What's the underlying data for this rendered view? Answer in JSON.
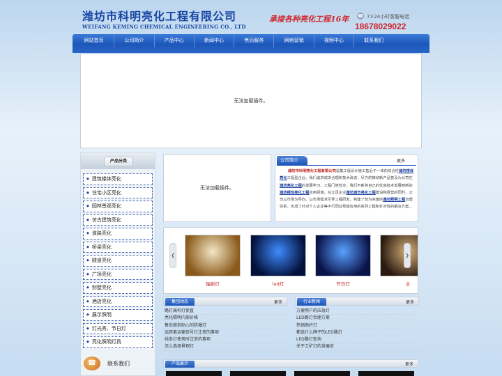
{
  "header": {
    "company_cn": "潍坊市科明亮化工程有限公司",
    "company_en": "WEIFANG KEMING CHEMICAL ENGINEERING CO., LTD",
    "slogan": "承接各种亮化工程16年",
    "hotline_label": "7×24小时客服电话",
    "hotline_number": "18678029022"
  },
  "nav": {
    "items": [
      "网站首页",
      "公司简介",
      "产品中心",
      "新闻中心",
      "售后服务",
      "网络营销",
      "视频中心",
      "联系我们"
    ]
  },
  "banner": {
    "plugin_message": "无法加载插件。"
  },
  "sidebar": {
    "title": "产品分类",
    "categories": [
      "建筑楼体亮化",
      "住宅小区亮化",
      "园林景观亮化",
      "仿古建筑亮化",
      "道路亮化",
      "桥梁亮化",
      "隧道亮化",
      "广场亮化",
      "别墅亮化",
      "酒店亮化",
      "展示照明",
      "灯光秀、节日灯",
      "亮化照明灯具"
    ],
    "contact_title": "联系我们"
  },
  "flash2": {
    "plugin_message": "无法加载插件。"
  },
  "about": {
    "tab": "公司简介",
    "more": "更多",
    "seg1": "潍坊市科明亮化工程有限公司",
    "seg2": "是集工程设计施工售后于一体的综合性",
    "seg3": "潍坊楼体亮化",
    "seg4": "工程型企业。我们追求成本合理和技术改进，尽力的推动新产品普及为公司在",
    "seg5": "潍坊亮化工程",
    "seg6": "的发展学习、工程门类较全，我们不断将自己的优良技术发展到新的",
    "seg7": "潍坊楼体亮化工程",
    "seg8": "应用领域。在立足企业",
    "seg9": "潍坊城市亮化工程",
    "seg10": "建设和经营的同时，公司以市场为导向，以市场需求引导工程研发，构建了较为完善的",
    "seg11": "潍坊照明工程",
    "seg12": "治理体系，形成了针对个人企业等不行同业规模应用的系列工程和针对性的解决方案..."
  },
  "products": {
    "prev": "❮",
    "next": "❯",
    "items": [
      {
        "label": "辐射灯",
        "color1": "#f4e6c4",
        "color2": "#8a5a1c"
      },
      {
        "label": "led灯",
        "color1": "#3f8cff",
        "color2": "#03103a"
      },
      {
        "label": "节日灯",
        "color1": "#5aa0ff",
        "color2": "#0a1248"
      },
      {
        "label": "文",
        "color1": "#d8b27a",
        "color2": "#2a1a10"
      }
    ]
  },
  "news_group": {
    "tab": "集团动态",
    "more": "更多",
    "items": [
      "路灯高杆灯使直",
      "亮化照明内部价格",
      "售后商到贴心的防爆灯",
      "远距离运输信号灯注意的事项",
      "线条灯使用时注意的事项",
      "怎么选择景观灯"
    ]
  },
  "news_industry": {
    "tab": "行业新闻",
    "more": "更多",
    "items": [
      "方便用户的应急灯",
      "LED路灯合理方案",
      "热销高杆灯",
      "都选什么牌子的LED路灯",
      "LED路灯查询",
      "关于工矿灯的发展史"
    ]
  },
  "display": {
    "tab": "产品展示",
    "more": "更多"
  }
}
